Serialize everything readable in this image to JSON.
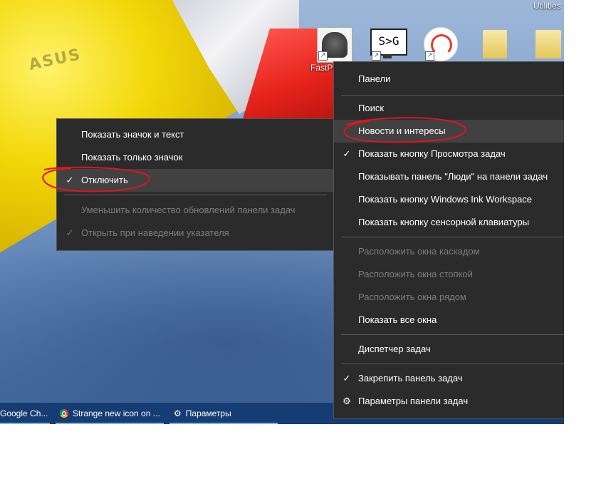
{
  "desktop": {
    "top_right_label": "Utilities",
    "fastphoto_label": "FastPh",
    "sg_icon_text": "S>G",
    "wallpaper_logo": "ASUS"
  },
  "submenu": {
    "items": [
      {
        "label": "Показать значок и текст",
        "checked": false,
        "disabled": false
      },
      {
        "label": "Показать только значок",
        "checked": false,
        "disabled": false
      },
      {
        "label": "Отключить",
        "checked": true,
        "disabled": false
      },
      {
        "label": "Уменьшить количество обновлений панели задач",
        "checked": false,
        "disabled": true
      },
      {
        "label": "Открыть при наведении указателя",
        "checked": true,
        "disabled": true
      }
    ]
  },
  "taskbar_menu": {
    "items": [
      {
        "label": "Панели"
      },
      {
        "label": "Поиск"
      },
      {
        "label": "Новости и интересы"
      },
      {
        "label": "Показать кнопку Просмотра задач",
        "checked": true
      },
      {
        "label": "Показывать панель \"Люди\" на панели задач"
      },
      {
        "label": "Показать кнопку Windows Ink Workspace"
      },
      {
        "label": "Показать кнопку сенсорной клавиатуры"
      },
      {
        "label": "Расположить окна каскадом",
        "disabled": true
      },
      {
        "label": "Расположить окна стопкой",
        "disabled": true
      },
      {
        "label": "Расположить окна рядом",
        "disabled": true
      },
      {
        "label": "Показать все окна"
      },
      {
        "label": "Диспетчер задач"
      },
      {
        "label": "Закрепить панель задач",
        "checked": true
      },
      {
        "label": "Параметры панели задач",
        "icon": "gear-icon"
      }
    ]
  },
  "taskbar": {
    "items": [
      {
        "label": "Google Ch...",
        "icon": "chrome-icon"
      },
      {
        "label": "Strange new icon on ...",
        "icon": "chrome-icon"
      },
      {
        "label": "Параметры",
        "icon": "gear-icon"
      }
    ]
  },
  "colors": {
    "menu_bg": "#2b2b2b",
    "annotation": "#e0141e",
    "taskbar": "#163d73"
  }
}
